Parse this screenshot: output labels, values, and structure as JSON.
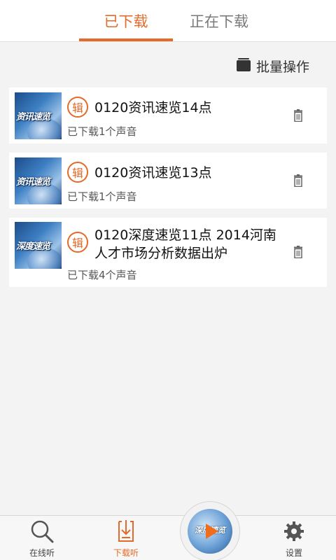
{
  "tabs": [
    {
      "label": "已下载",
      "active": true
    },
    {
      "label": "正在下载",
      "active": false
    }
  ],
  "batch": {
    "label": "批量操作",
    "icon": "folder-icon"
  },
  "items": [
    {
      "thumb_text": "资讯速览",
      "badge": "辑",
      "title": "0120资讯速览14点",
      "sub": "已下载1个声音"
    },
    {
      "thumb_text": "资讯速览",
      "badge": "辑",
      "title": "0120资讯速览13点",
      "sub": "已下载1个声音"
    },
    {
      "thumb_text": "深度速览",
      "badge": "辑",
      "title": "0120深度速览11点 2014河南人才市场分析数据出炉",
      "sub": "已下载4个声音"
    }
  ],
  "nav": [
    {
      "label": "在线听",
      "icon": "search-icon",
      "active": false
    },
    {
      "label": "下载听",
      "icon": "download-icon",
      "active": true
    },
    {
      "label": "",
      "icon": "play-icon",
      "active": false
    },
    {
      "label": "设置",
      "icon": "gear-icon",
      "active": false
    }
  ],
  "player": {
    "thumb_text": "深度速览"
  },
  "colors": {
    "accent": "#e46a2a",
    "background": "#f3f3f3"
  }
}
